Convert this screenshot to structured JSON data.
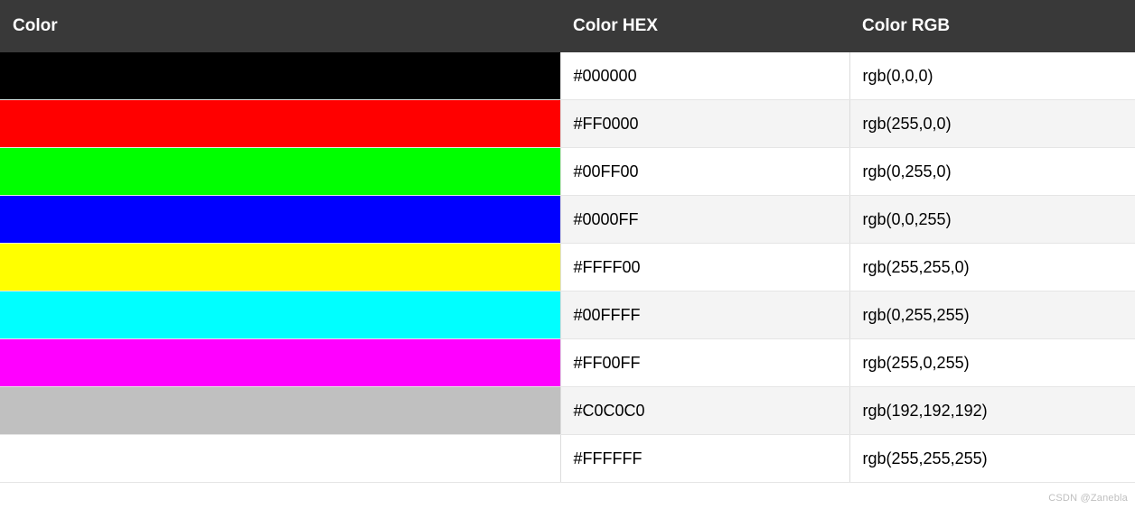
{
  "headers": {
    "color": "Color",
    "hex": "Color HEX",
    "rgb": "Color RGB"
  },
  "rows": [
    {
      "swatch": "#000000",
      "hex": "#000000",
      "rgb": "rgb(0,0,0)"
    },
    {
      "swatch": "#FF0000",
      "hex": "#FF0000",
      "rgb": "rgb(255,0,0)"
    },
    {
      "swatch": "#00FF00",
      "hex": "#00FF00",
      "rgb": "rgb(0,255,0)"
    },
    {
      "swatch": "#0000FF",
      "hex": "#0000FF",
      "rgb": "rgb(0,0,255)"
    },
    {
      "swatch": "#FFFF00",
      "hex": "#FFFF00",
      "rgb": "rgb(255,255,0)"
    },
    {
      "swatch": "#00FFFF",
      "hex": "#00FFFF",
      "rgb": "rgb(0,255,255)"
    },
    {
      "swatch": "#FF00FF",
      "hex": "#FF00FF",
      "rgb": "rgb(255,0,255)"
    },
    {
      "swatch": "#C0C0C0",
      "hex": "#C0C0C0",
      "rgb": "rgb(192,192,192)"
    },
    {
      "swatch": "#FFFFFF",
      "hex": "#FFFFFF",
      "rgb": "rgb(255,255,255)"
    }
  ],
  "watermark": "CSDN @Zanebla"
}
